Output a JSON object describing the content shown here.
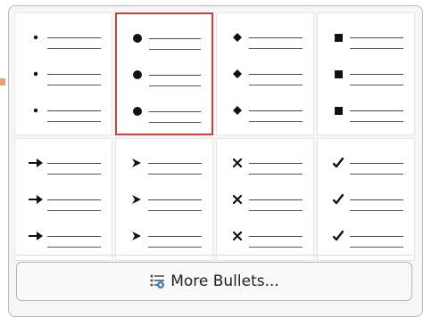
{
  "bullets_popup": {
    "presets": [
      {
        "id": "small-dot",
        "icon": "small-dot-bullet-icon"
      },
      {
        "id": "large-dot",
        "icon": "large-dot-bullet-icon",
        "selected": true
      },
      {
        "id": "diamond",
        "icon": "diamond-bullet-icon"
      },
      {
        "id": "square",
        "icon": "square-bullet-icon"
      },
      {
        "id": "bold-arrow",
        "icon": "bold-arrow-bullet-icon"
      },
      {
        "id": "arrowhead",
        "icon": "arrowhead-bullet-icon"
      },
      {
        "id": "cross",
        "icon": "cross-bullet-icon"
      },
      {
        "id": "check",
        "icon": "check-bullet-icon"
      }
    ],
    "selected_color": "#c9413e",
    "more_button": {
      "label": "More Bullets...",
      "icon": "bullets-list-icon"
    }
  }
}
